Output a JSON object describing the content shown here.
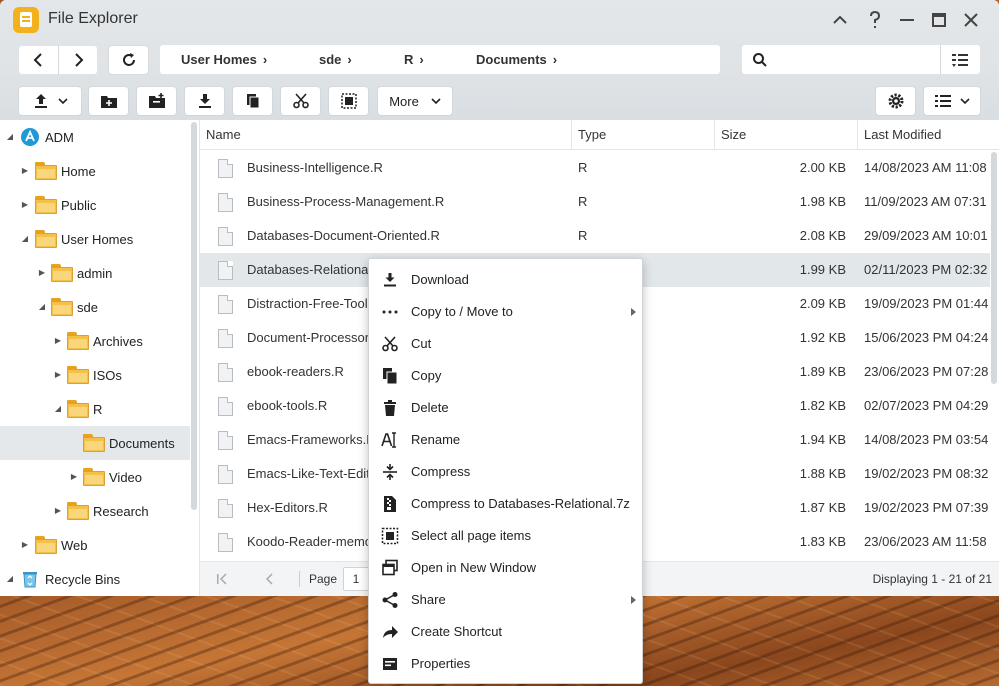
{
  "window": {
    "title": "File Explorer",
    "controls": [
      "chevron-up-icon",
      "help-icon",
      "minimize-icon",
      "maximize-icon",
      "close-icon"
    ]
  },
  "breadcrumb": [
    "User Homes",
    "sde",
    "R",
    "Documents"
  ],
  "search": {
    "placeholder": "",
    "value": ""
  },
  "toolbar": {
    "more_label": "More"
  },
  "sidebar": {
    "items": [
      {
        "label": "ADM",
        "icon": "adm-icon",
        "expanded": true
      },
      {
        "label": "Home"
      },
      {
        "label": "Public"
      },
      {
        "label": "User Homes",
        "expanded": true
      },
      {
        "label": "admin"
      },
      {
        "label": "sde",
        "expanded": true
      },
      {
        "label": "Archives"
      },
      {
        "label": "ISOs"
      },
      {
        "label": "R",
        "expanded": true
      },
      {
        "label": "Documents",
        "selected": true
      },
      {
        "label": "Video"
      },
      {
        "label": "Research"
      },
      {
        "label": "Web"
      },
      {
        "label": "Recycle Bins",
        "icon": "recycle-bin-icon"
      }
    ]
  },
  "columns": {
    "name": "Name",
    "type": "Type",
    "size": "Size",
    "modified": "Last Modified"
  },
  "files": [
    {
      "name": "Business-Intelligence.R",
      "type": "R",
      "size": "2.00 KB",
      "modified": "14/08/2023 AM 11:08"
    },
    {
      "name": "Business-Process-Management.R",
      "type": "R",
      "size": "1.98 KB",
      "modified": "11/09/2023 AM 07:31"
    },
    {
      "name": "Databases-Document-Oriented.R",
      "type": "R",
      "size": "2.08 KB",
      "modified": "29/09/2023 AM 10:01"
    },
    {
      "name": "Databases-Relationa",
      "type": "",
      "size": "1.99 KB",
      "modified": "02/11/2023 PM 02:32",
      "selected": true
    },
    {
      "name": "Distraction-Free-Tool",
      "type": "",
      "size": "2.09 KB",
      "modified": "19/09/2023 PM 01:44"
    },
    {
      "name": "Document-Processor",
      "type": "",
      "size": "1.92 KB",
      "modified": "15/06/2023 PM 04:24"
    },
    {
      "name": "ebook-readers.R",
      "type": "",
      "size": "1.89 KB",
      "modified": "23/06/2023 PM 07:28"
    },
    {
      "name": "ebook-tools.R",
      "type": "",
      "size": "1.82 KB",
      "modified": "02/07/2023 PM 04:29"
    },
    {
      "name": "Emacs-Frameworks.I",
      "type": "",
      "size": "1.94 KB",
      "modified": "14/08/2023 PM 03:54"
    },
    {
      "name": "Emacs-Like-Text-Edit",
      "type": "",
      "size": "1.88 KB",
      "modified": "19/02/2023 PM 08:32"
    },
    {
      "name": "Hex-Editors.R",
      "type": "",
      "size": "1.87 KB",
      "modified": "19/02/2023 PM 07:39"
    },
    {
      "name": "Koodo-Reader-memo",
      "type": "",
      "size": "1.83 KB",
      "modified": "23/06/2023 AM 11:58"
    }
  ],
  "pager": {
    "page_label": "Page",
    "page_value": "1",
    "displaying": "Displaying 1 - 21 of 21"
  },
  "context_menu": [
    {
      "label": "Download",
      "icon": "download-icon"
    },
    {
      "label": "Copy to / Move to",
      "icon": "more-dots-icon",
      "submenu": true
    },
    {
      "label": "Cut",
      "icon": "scissors-icon"
    },
    {
      "label": "Copy",
      "icon": "copy-icon"
    },
    {
      "label": "Delete",
      "icon": "trash-icon"
    },
    {
      "label": "Rename",
      "icon": "rename-icon"
    },
    {
      "label": "Compress",
      "icon": "compress-icon"
    },
    {
      "label": "Compress to Databases-Relational.7z",
      "icon": "compress-file-icon"
    },
    {
      "label": "Select all page items",
      "icon": "select-all-icon"
    },
    {
      "label": "Open in New Window",
      "icon": "new-window-icon"
    },
    {
      "label": "Share",
      "icon": "share-icon",
      "submenu": true
    },
    {
      "label": "Create Shortcut",
      "icon": "shortcut-icon"
    },
    {
      "label": "Properties",
      "icon": "properties-icon"
    }
  ]
}
